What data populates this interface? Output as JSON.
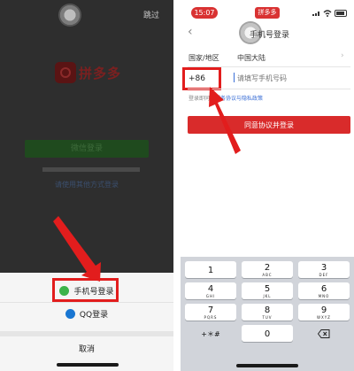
{
  "left_screen": {
    "skip_label": "跳过",
    "brand_name": "拼多多",
    "wechat_login_label": "微信登录",
    "other_methods_link": "请使用其他方式登录",
    "sheet": {
      "phone_login_label": "手机号登录",
      "qq_login_label": "QQ登录",
      "cancel_label": "取消"
    }
  },
  "right_screen": {
    "status_bar": {
      "time": "15:07",
      "app_badge": "拼多多"
    },
    "title": "手机号登录",
    "region_label": "国家/地区",
    "region_value": "中国大陆",
    "country_code": "+86",
    "phone_placeholder": "请填写手机号码",
    "policy_prefix": "登录即同意",
    "policy_link": "服务协议与隐私政策",
    "agree_button": "同意协议并登录",
    "keypad": [
      {
        "num": "1",
        "letters": ""
      },
      {
        "num": "2",
        "letters": "ABC"
      },
      {
        "num": "3",
        "letters": "DEF"
      },
      {
        "num": "4",
        "letters": "GHI"
      },
      {
        "num": "5",
        "letters": "JKL"
      },
      {
        "num": "6",
        "letters": "MNO"
      },
      {
        "num": "7",
        "letters": "PQRS"
      },
      {
        "num": "8",
        "letters": "TUV"
      },
      {
        "num": "9",
        "letters": "WXYZ"
      },
      {
        "symbols": "+＊#"
      },
      {
        "num": "0"
      },
      {
        "icon": "backspace-icon"
      }
    ]
  },
  "highlight_color": "#e21d1d",
  "brand_red": "#d92b2b"
}
